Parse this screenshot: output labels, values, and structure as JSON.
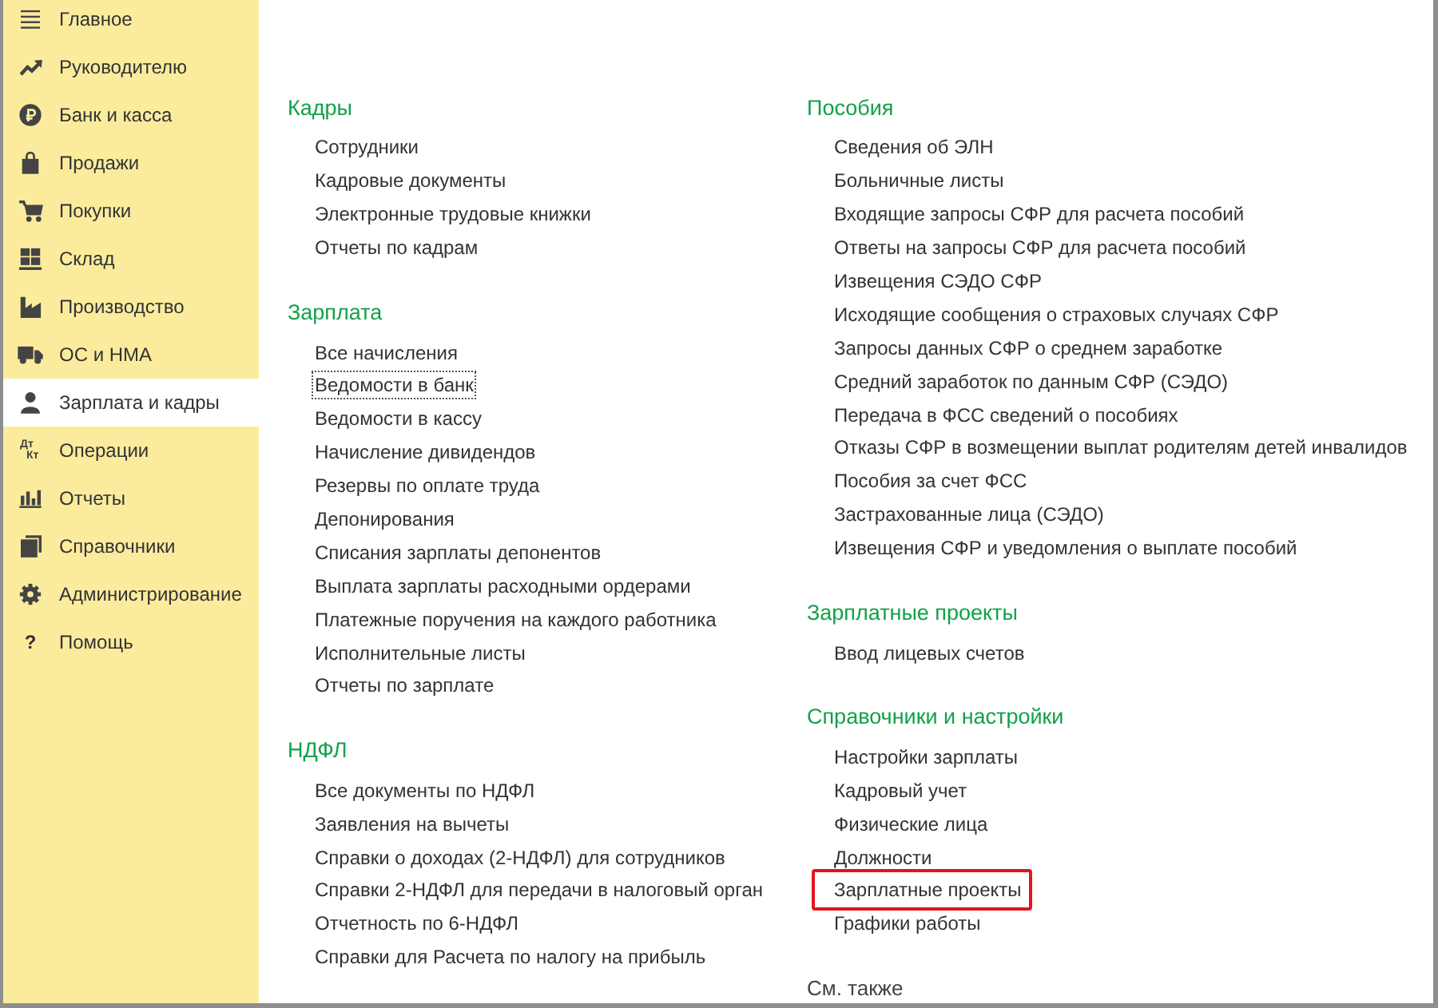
{
  "sidebar": {
    "items": [
      {
        "label": "Главное",
        "selected": false
      },
      {
        "label": "Руководителю",
        "selected": false
      },
      {
        "label": "Банк и касса",
        "selected": false
      },
      {
        "label": "Продажи",
        "selected": false
      },
      {
        "label": "Покупки",
        "selected": false
      },
      {
        "label": "Склад",
        "selected": false
      },
      {
        "label": "Производство",
        "selected": false
      },
      {
        "label": "ОС и НМА",
        "selected": false
      },
      {
        "label": "Зарплата и кадры",
        "selected": true
      },
      {
        "label": "Операции",
        "selected": false,
        "icon_text": "Дт Кт"
      },
      {
        "label": "Отчеты",
        "selected": false
      },
      {
        "label": "Справочники",
        "selected": false
      },
      {
        "label": "Администрирование",
        "selected": false
      },
      {
        "label": "Помощь",
        "selected": false,
        "icon_text": "?"
      }
    ]
  },
  "columns": [
    {
      "sections": [
        {
          "title": "Кадры",
          "links": [
            {
              "label": "Сотрудники",
              "focused": false,
              "highlighted": false
            },
            {
              "label": "Кадровые документы",
              "focused": false,
              "highlighted": false
            },
            {
              "label": "Электронные трудовые книжки",
              "focused": false,
              "highlighted": false
            },
            {
              "label": "Отчеты по кадрам",
              "focused": false,
              "highlighted": false
            }
          ]
        },
        {
          "title": "Зарплата",
          "links": [
            {
              "label": "Все начисления",
              "focused": false,
              "highlighted": false
            },
            {
              "label": "Ведомости в банк",
              "focused": true,
              "highlighted": false
            },
            {
              "label": "Ведомости в кассу",
              "focused": false,
              "highlighted": false
            },
            {
              "label": "Начисление дивидендов",
              "focused": false,
              "highlighted": false
            },
            {
              "label": "Резервы по оплате труда",
              "focused": false,
              "highlighted": false
            },
            {
              "label": "Депонирования",
              "focused": false,
              "highlighted": false
            },
            {
              "label": "Списания зарплаты депонентов",
              "focused": false,
              "highlighted": false
            },
            {
              "label": "Выплата зарплаты расходными ордерами",
              "focused": false,
              "highlighted": false
            },
            {
              "label": "Платежные поручения на каждого работника",
              "focused": false,
              "highlighted": false
            },
            {
              "label": "Исполнительные листы",
              "focused": false,
              "highlighted": false
            },
            {
              "label": "Отчеты по зарплате",
              "focused": false,
              "highlighted": false
            }
          ]
        },
        {
          "title": "НДФЛ",
          "links": [
            {
              "label": "Все документы по НДФЛ",
              "focused": false,
              "highlighted": false
            },
            {
              "label": "Заявления на вычеты",
              "focused": false,
              "highlighted": false
            },
            {
              "label": "Справки о доходах (2-НДФЛ) для сотрудников",
              "focused": false,
              "highlighted": false
            },
            {
              "label": "Справки 2-НДФЛ для передачи в налоговый орган",
              "focused": false,
              "highlighted": false
            },
            {
              "label": "Отчетность по 6-НДФЛ",
              "focused": false,
              "highlighted": false
            },
            {
              "label": "Справки для Расчета по налогу на прибыль",
              "focused": false,
              "highlighted": false
            }
          ]
        }
      ]
    },
    {
      "sections": [
        {
          "title": "Пособия",
          "links": [
            {
              "label": "Сведения об ЭЛН",
              "focused": false,
              "highlighted": false
            },
            {
              "label": "Больничные листы",
              "focused": false,
              "highlighted": false
            },
            {
              "label": "Входящие запросы СФР для расчета пособий",
              "focused": false,
              "highlighted": false
            },
            {
              "label": "Ответы на запросы СФР для расчета пособий",
              "focused": false,
              "highlighted": false
            },
            {
              "label": "Извещения СЭДО СФР",
              "focused": false,
              "highlighted": false
            },
            {
              "label": "Исходящие сообщения о страховых случаях СФР",
              "focused": false,
              "highlighted": false
            },
            {
              "label": "Запросы данных СФР о среднем заработке",
              "focused": false,
              "highlighted": false
            },
            {
              "label": "Средний заработок по данным СФР (СЭДО)",
              "focused": false,
              "highlighted": false
            },
            {
              "label": "Передача в ФСС сведений о пособиях",
              "focused": false,
              "highlighted": false
            },
            {
              "label": "Отказы СФР в возмещении выплат родителям детей инвалидов",
              "focused": false,
              "highlighted": false
            },
            {
              "label": "Пособия за счет ФСС",
              "focused": false,
              "highlighted": false
            },
            {
              "label": "Застрахованные лица (СЭДО)",
              "focused": false,
              "highlighted": false
            },
            {
              "label": "Извещения СФР и уведомления о выплате пособий",
              "focused": false,
              "highlighted": false
            }
          ]
        },
        {
          "title": "Зарплатные проекты",
          "links": [
            {
              "label": "Ввод лицевых счетов",
              "focused": false,
              "highlighted": false
            }
          ]
        },
        {
          "title": "Справочники и настройки",
          "links": [
            {
              "label": "Настройки зарплаты",
              "focused": false,
              "highlighted": false
            },
            {
              "label": "Кадровый учет",
              "focused": false,
              "highlighted": false
            },
            {
              "label": "Физические лица",
              "focused": false,
              "highlighted": false
            },
            {
              "label": "Должности",
              "focused": false,
              "highlighted": false
            },
            {
              "label": "Зарплатные проекты",
              "focused": false,
              "highlighted": true
            },
            {
              "label": "Графики работы",
              "focused": false,
              "highlighted": false
            }
          ]
        }
      ],
      "see_also": "См. также"
    }
  ]
}
